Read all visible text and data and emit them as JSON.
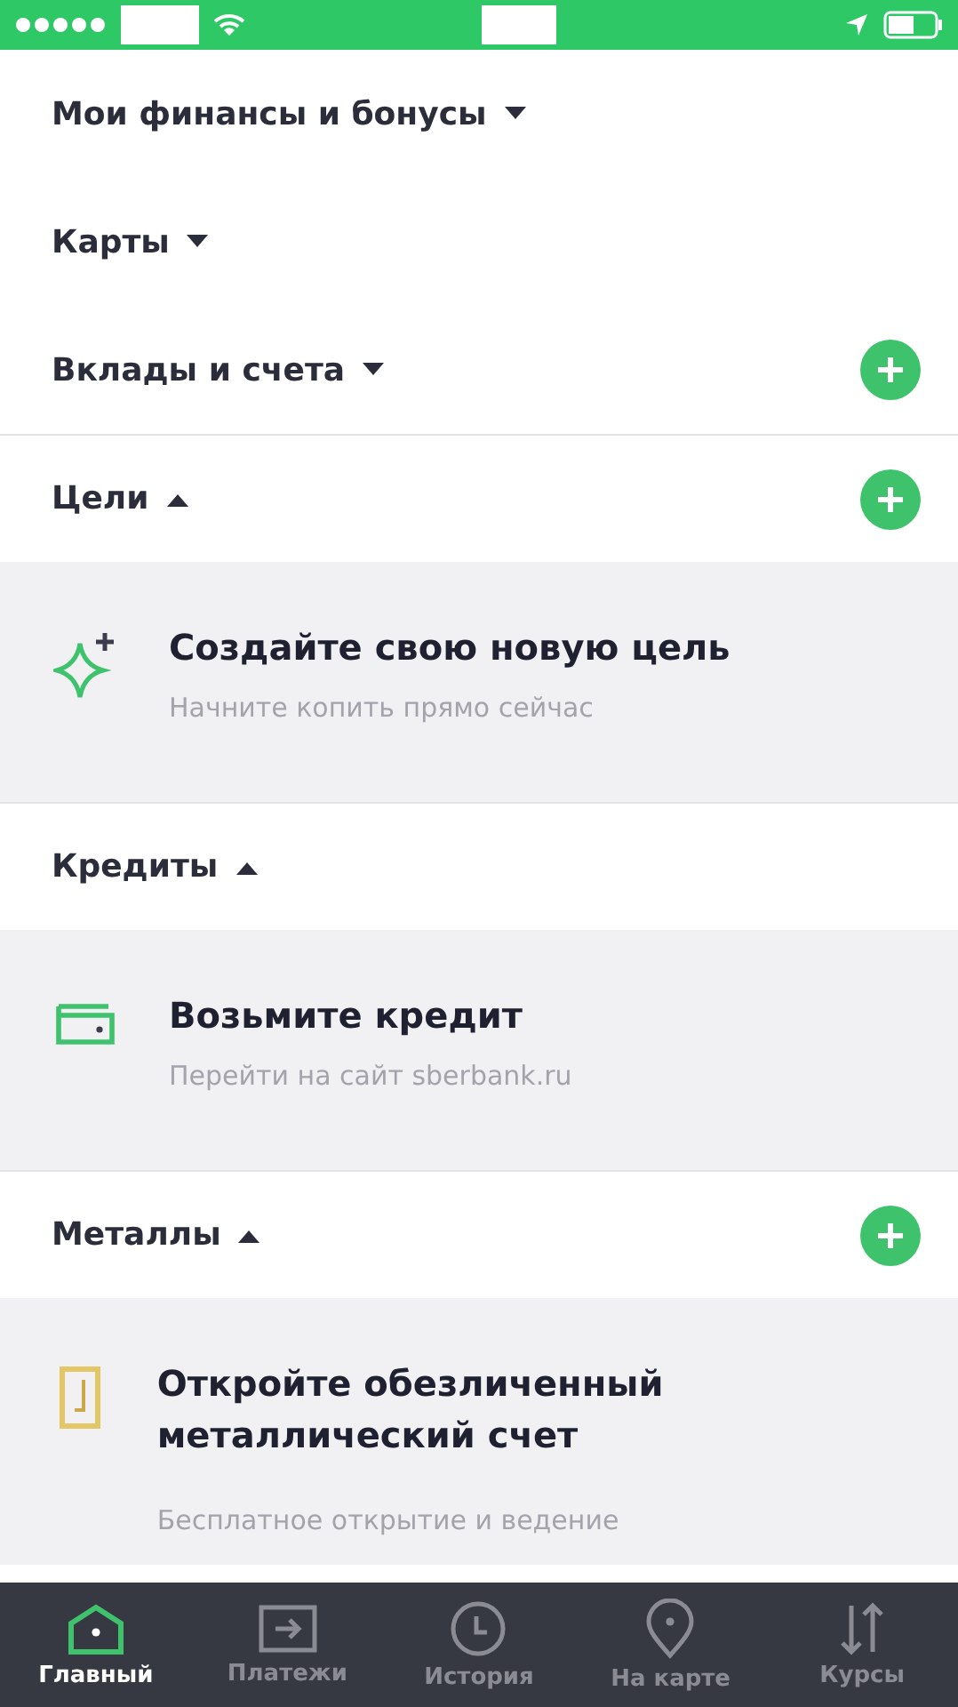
{
  "sections": [
    {
      "title": "Мои финансы и бонусы",
      "expanded": false,
      "has_add": false
    },
    {
      "title": "Карты",
      "expanded": false,
      "has_add": false
    },
    {
      "title": "Вклады и счета",
      "expanded": false,
      "has_add": true
    },
    {
      "title": "Цели",
      "expanded": true,
      "has_add": true,
      "promo": {
        "kind": "sparkle",
        "title": "Создайте свою новую цель",
        "subtitle": "Начните копить прямо сейчас"
      }
    },
    {
      "title": "Кредиты",
      "expanded": true,
      "has_add": false,
      "promo": {
        "kind": "wallet",
        "title": "Возьмите кредит",
        "subtitle": "Перейти на сайт sberbank.ru"
      }
    },
    {
      "title": "Металлы",
      "expanded": true,
      "has_add": true,
      "promo": {
        "kind": "bar",
        "title": "Откройте обезличенный металлический счет",
        "subtitle": "Бесплатное открытие и ведение"
      }
    }
  ],
  "tabs": [
    {
      "kind": "home",
      "label": "Главный",
      "selected": true
    },
    {
      "kind": "payments",
      "label": "Платежи",
      "selected": false
    },
    {
      "kind": "history",
      "label": "История",
      "selected": false
    },
    {
      "kind": "map",
      "label": "На карте",
      "selected": false
    },
    {
      "kind": "rates",
      "label": "Курсы",
      "selected": false
    }
  ]
}
